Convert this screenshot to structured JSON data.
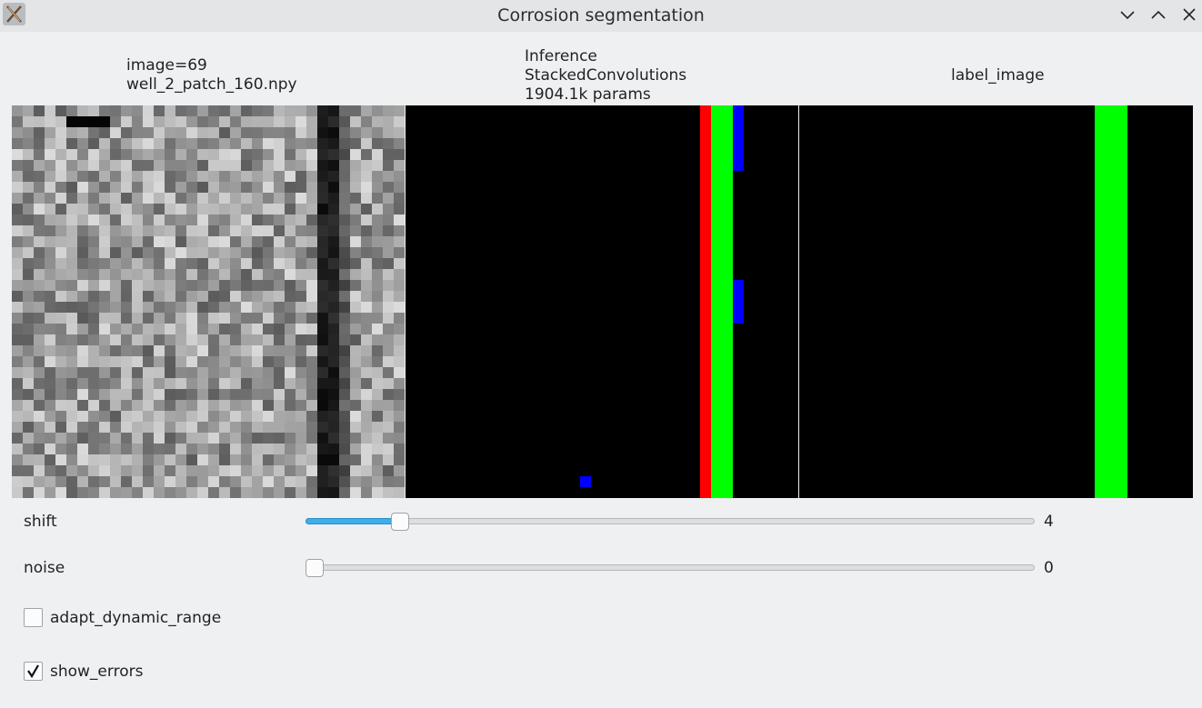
{
  "window": {
    "title": "Corrosion segmentation",
    "icon": "x-app-icon",
    "controls": [
      "minimize-icon",
      "maximize-icon",
      "close-icon"
    ]
  },
  "panels": {
    "input_title": "image=69\nwell_2_patch_160.npy",
    "inference_title": "Inference\nStackedConvolutions\n1904.1k params",
    "label_title": "label_image"
  },
  "controls": {
    "shift": {
      "label": "shift",
      "value": "4",
      "fraction": 0.12
    },
    "noise": {
      "label": "noise",
      "value": "0",
      "fraction": 0.0
    },
    "adapt_dynamic_range": {
      "label": "adapt_dynamic_range",
      "checked": false
    },
    "show_errors": {
      "label": "show_errors",
      "checked": true
    }
  },
  "colors": {
    "prediction_red": "#ff0000",
    "prediction_green": "#00ff00",
    "error_blue": "#0000ff",
    "slider_accent": "#3daee9"
  }
}
